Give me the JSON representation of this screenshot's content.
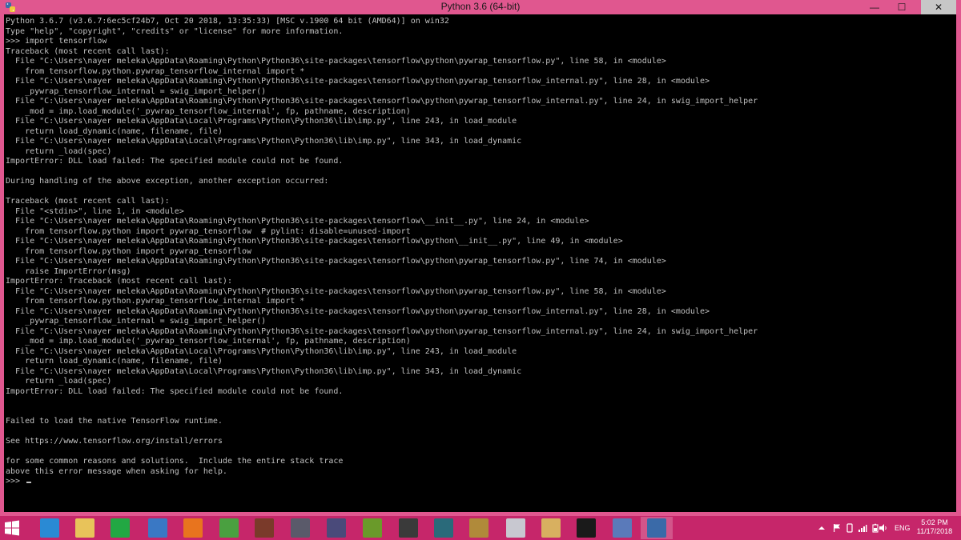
{
  "window": {
    "title": "Python 3.6 (64-bit)",
    "minimize_glyph": "—",
    "maximize_glyph": "☐",
    "close_glyph": "✕"
  },
  "console": {
    "lines": [
      "Python 3.6.7 (v3.6.7:6ec5cf24b7, Oct 20 2018, 13:35:33) [MSC v.1900 64 bit (AMD64)] on win32",
      "Type \"help\", \"copyright\", \"credits\" or \"license\" for more information.",
      ">>> import tensorflow",
      "Traceback (most recent call last):",
      "  File \"C:\\Users\\nayer meleka\\AppData\\Roaming\\Python\\Python36\\site-packages\\tensorflow\\python\\pywrap_tensorflow.py\", line 58, in <module>",
      "    from tensorflow.python.pywrap_tensorflow_internal import *",
      "  File \"C:\\Users\\nayer meleka\\AppData\\Roaming\\Python\\Python36\\site-packages\\tensorflow\\python\\pywrap_tensorflow_internal.py\", line 28, in <module>",
      "    _pywrap_tensorflow_internal = swig_import_helper()",
      "  File \"C:\\Users\\nayer meleka\\AppData\\Roaming\\Python\\Python36\\site-packages\\tensorflow\\python\\pywrap_tensorflow_internal.py\", line 24, in swig_import_helper",
      "    _mod = imp.load_module('_pywrap_tensorflow_internal', fp, pathname, description)",
      "  File \"C:\\Users\\nayer meleka\\AppData\\Local\\Programs\\Python\\Python36\\lib\\imp.py\", line 243, in load_module",
      "    return load_dynamic(name, filename, file)",
      "  File \"C:\\Users\\nayer meleka\\AppData\\Local\\Programs\\Python\\Python36\\lib\\imp.py\", line 343, in load_dynamic",
      "    return _load(spec)",
      "ImportError: DLL load failed: The specified module could not be found.",
      "",
      "During handling of the above exception, another exception occurred:",
      "",
      "Traceback (most recent call last):",
      "  File \"<stdin>\", line 1, in <module>",
      "  File \"C:\\Users\\nayer meleka\\AppData\\Roaming\\Python\\Python36\\site-packages\\tensorflow\\__init__.py\", line 24, in <module>",
      "    from tensorflow.python import pywrap_tensorflow  # pylint: disable=unused-import",
      "  File \"C:\\Users\\nayer meleka\\AppData\\Roaming\\Python\\Python36\\site-packages\\tensorflow\\python\\__init__.py\", line 49, in <module>",
      "    from tensorflow.python import pywrap_tensorflow",
      "  File \"C:\\Users\\nayer meleka\\AppData\\Roaming\\Python\\Python36\\site-packages\\tensorflow\\python\\pywrap_tensorflow.py\", line 74, in <module>",
      "    raise ImportError(msg)",
      "ImportError: Traceback (most recent call last):",
      "  File \"C:\\Users\\nayer meleka\\AppData\\Roaming\\Python\\Python36\\site-packages\\tensorflow\\python\\pywrap_tensorflow.py\", line 58, in <module>",
      "    from tensorflow.python.pywrap_tensorflow_internal import *",
      "  File \"C:\\Users\\nayer meleka\\AppData\\Roaming\\Python\\Python36\\site-packages\\tensorflow\\python\\pywrap_tensorflow_internal.py\", line 28, in <module>",
      "    _pywrap_tensorflow_internal = swig_import_helper()",
      "  File \"C:\\Users\\nayer meleka\\AppData\\Roaming\\Python\\Python36\\site-packages\\tensorflow\\python\\pywrap_tensorflow_internal.py\", line 24, in swig_import_helper",
      "    _mod = imp.load_module('_pywrap_tensorflow_internal', fp, pathname, description)",
      "  File \"C:\\Users\\nayer meleka\\AppData\\Local\\Programs\\Python\\Python36\\lib\\imp.py\", line 243, in load_module",
      "    return load_dynamic(name, filename, file)",
      "  File \"C:\\Users\\nayer meleka\\AppData\\Local\\Programs\\Python\\Python36\\lib\\imp.py\", line 343, in load_dynamic",
      "    return _load(spec)",
      "ImportError: DLL load failed: The specified module could not be found.",
      "",
      "",
      "Failed to load the native TensorFlow runtime.",
      "",
      "See https://www.tensorflow.org/install/errors",
      "",
      "for some common reasons and solutions.  Include the entire stack trace",
      "above this error message when asking for help.",
      ">>> "
    ]
  },
  "taskbar": {
    "apps": [
      {
        "name": "internet-explorer",
        "color": "#2a8ad4",
        "active": false
      },
      {
        "name": "file-explorer",
        "color": "#e8c35a",
        "active": false
      },
      {
        "name": "store",
        "color": "#22a843",
        "active": false
      },
      {
        "name": "remote-desktop",
        "color": "#3a78c4",
        "active": false
      },
      {
        "name": "firefox",
        "color": "#e8741e",
        "active": false
      },
      {
        "name": "globe-app",
        "color": "#4aa040",
        "active": false
      },
      {
        "name": "game-character-1",
        "color": "#7a3a2a",
        "active": false
      },
      {
        "name": "game-helmet",
        "color": "#5a5a6a",
        "active": false
      },
      {
        "name": "game-character-2",
        "color": "#4a4a7a",
        "active": false
      },
      {
        "name": "game-character-3",
        "color": "#6a9a2a",
        "active": false
      },
      {
        "name": "calendar-app",
        "color": "#3a3a3a",
        "active": false
      },
      {
        "name": "league-app",
        "color": "#2a6a7a",
        "active": false
      },
      {
        "name": "league-client",
        "color": "#b08a3a",
        "active": false
      },
      {
        "name": "mail-app",
        "color": "#c8c8d0",
        "active": false
      },
      {
        "name": "notepad-app",
        "color": "#d8b060",
        "active": false
      },
      {
        "name": "command-prompt",
        "color": "#1a1a1a",
        "active": false
      },
      {
        "name": "network-app",
        "color": "#5a7aba",
        "active": false
      },
      {
        "name": "python-app",
        "color": "#3a6aa8",
        "active": true
      }
    ],
    "tray": {
      "language": "ENG",
      "time": "5:02 PM",
      "date": "11/17/2018"
    }
  }
}
